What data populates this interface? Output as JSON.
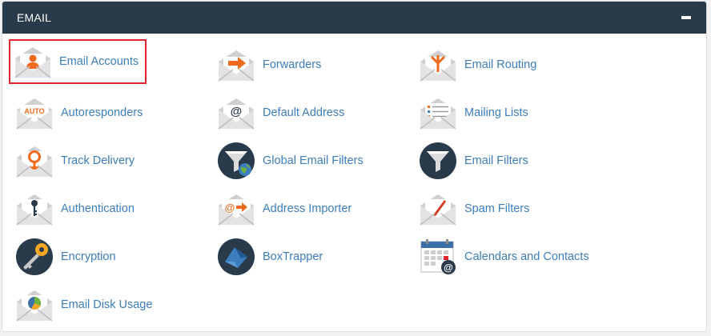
{
  "panel": {
    "title": "EMAIL",
    "collapse_icon": "minus-icon"
  },
  "colors": {
    "header_bg": "#293a4a",
    "link": "#3b7dbd",
    "accent_orange": "#f06a1d",
    "highlight_red": "#e0262c"
  },
  "items": [
    {
      "label": "Email Accounts",
      "icon": "email-accounts-icon"
    },
    {
      "label": "Forwarders",
      "icon": "forwarders-icon"
    },
    {
      "label": "Email Routing",
      "icon": "email-routing-icon"
    },
    {
      "label": "Autoresponders",
      "icon": "autoresponders-icon",
      "icon_text": "AUTO"
    },
    {
      "label": "Default Address",
      "icon": "default-address-icon"
    },
    {
      "label": "Mailing Lists",
      "icon": "mailing-lists-icon"
    },
    {
      "label": "Track Delivery",
      "icon": "track-delivery-icon"
    },
    {
      "label": "Global Email Filters",
      "icon": "global-email-filters-icon"
    },
    {
      "label": "Email Filters",
      "icon": "email-filters-icon"
    },
    {
      "label": "Authentication",
      "icon": "authentication-icon"
    },
    {
      "label": "Address Importer",
      "icon": "address-importer-icon"
    },
    {
      "label": "Spam Filters",
      "icon": "spam-filters-icon"
    },
    {
      "label": "Encryption",
      "icon": "encryption-icon"
    },
    {
      "label": "BoxTrapper",
      "icon": "boxtrapper-icon"
    },
    {
      "label": "Calendars and Contacts",
      "icon": "calendars-contacts-icon"
    },
    {
      "label": "Email Disk Usage",
      "icon": "email-disk-usage-icon"
    }
  ],
  "selected_item": "Email Accounts"
}
